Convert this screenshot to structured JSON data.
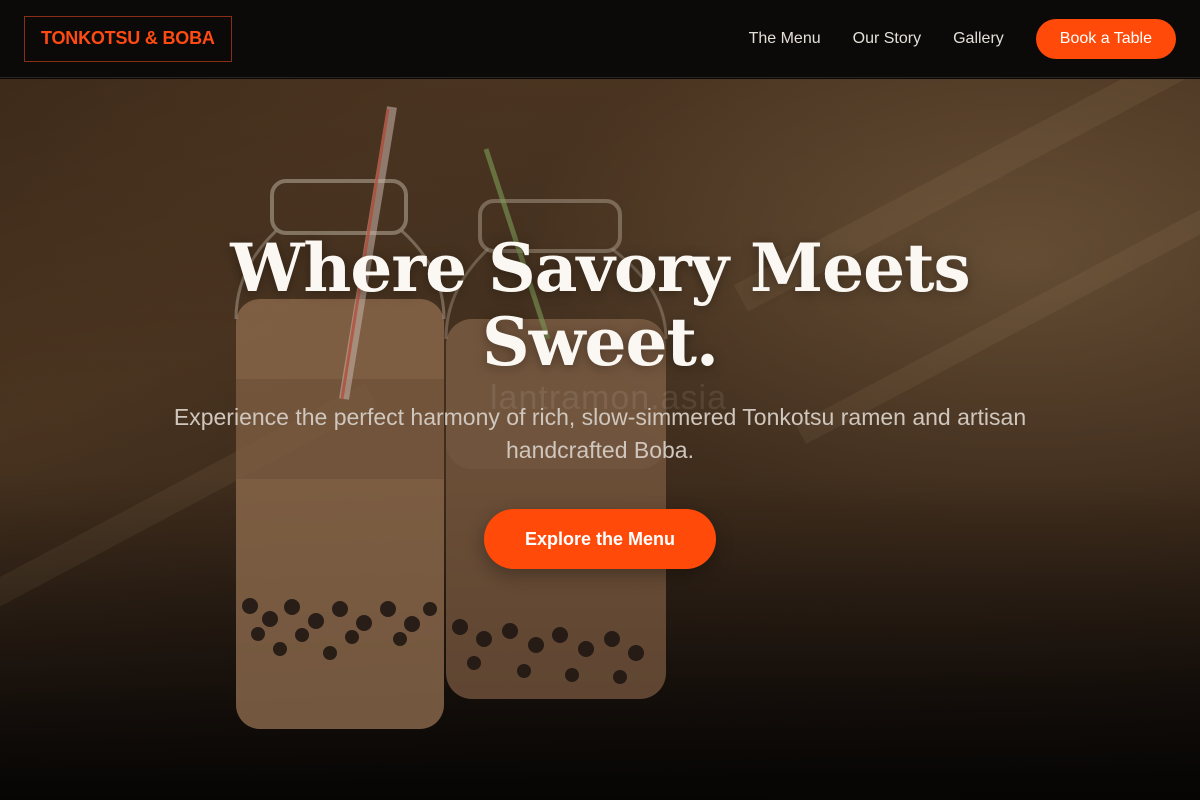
{
  "brand": {
    "name": "TONKOTSU & BOBA"
  },
  "nav": {
    "links": [
      {
        "label": "The Menu"
      },
      {
        "label": "Our Story"
      },
      {
        "label": "Gallery"
      }
    ],
    "cta_label": "Book a Table"
  },
  "hero": {
    "headline": "Where Savory Meets Sweet.",
    "subtext": "Experience the perfect harmony of rich, slow-simmered Tonkotsu ramen and artisan handcrafted Boba.",
    "cta_label": "Explore the Menu",
    "photo_watermark": "lantramon.asia",
    "background_description_icon": "boba-bottles-photo"
  },
  "colors": {
    "accent": "#ff4a0a",
    "header_bg": "#0b0a09",
    "headline": "#fbf8f3",
    "nav_text": "#e4ded7"
  }
}
